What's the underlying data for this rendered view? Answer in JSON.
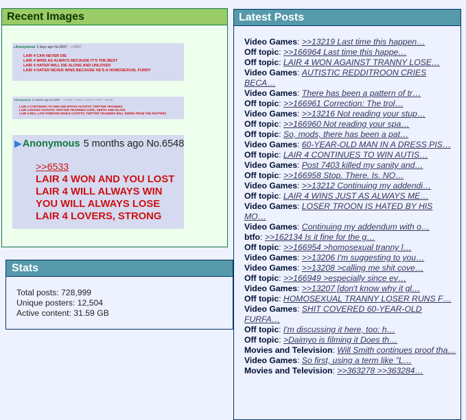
{
  "recent_images": {
    "title": "Recent Images",
    "thumbs": [
      {
        "poster": "Anonymous",
        "meta": "3 days ago No.8827",
        "mini": ">>8847",
        "lines": [
          "LAIR 4 CAN NEVER DIE",
          "LAIR 4 WINS AS ALWAYS BECAUSE IT'S THE BEST",
          "LAIR 4 HATER WILL DIE ALONE AND UNLOVED",
          "LAIR 4 HATER NEVER WINS BECAUSE HE'S A HOMOSEXUAL FURRY"
        ]
      },
      {
        "poster": "Anonymous",
        "meta": "5 months ago No.6525",
        "mini": ">>6533  >>6534  >>6535  >>6537  >>6538",
        "lines": [
          "LAIR 4 CONTINUES TO WIN AND BTFOS AUTISTIC TWITTER TRANNIES",
          "LAIR 4 MAKES AUTISTIC TWITTER TRANNIES COPE, SEETH AND DILATE",
          "LAIR 4 WILL LIVE FOREVER WHILE AUTISTIC TWITTER TRANNIES WILL SWING FROM THE RAFTERS"
        ]
      },
      {
        "poster": "Anonymous",
        "meta": "5 months ago No.6548",
        "quote": ">>6533",
        "lines": [
          "LAIR 4 WON AND YOU LOST",
          "LAIR 4 WILL ALWAYS WIN",
          "YOU WILL ALWAYS LOSE",
          "LAIR 4 LOVERS, STRONG"
        ]
      }
    ]
  },
  "stats": {
    "title": "Stats",
    "total_posts": "Total posts: 728,999",
    "unique_posters": "Unique posters: 12,504",
    "active_content": "Active content: 31.59 GB"
  },
  "latest_posts": {
    "title": "Latest Posts",
    "items": [
      {
        "board": "Video Games",
        "text": ">>13219 Last time this happen…"
      },
      {
        "board": "Off topic",
        "text": ">>166964 Last time this happe…"
      },
      {
        "board": "Off topic",
        "text": "LAIR 4 WON AGAINST TRANNY LOSE…"
      },
      {
        "board": "Video Games",
        "text": "AUTISTIC REDDITROON CRIES BECA…"
      },
      {
        "board": "Video Games",
        "text": "There has been a pattern of tr…"
      },
      {
        "board": "Off topic",
        "text": ">>166961 Correction: The trol…"
      },
      {
        "board": "Video Games",
        "text": ">>13216 Not reading your stup…"
      },
      {
        "board": "Off topic",
        "text": ">>166960 Not reading your spa…"
      },
      {
        "board": "Off topic",
        "text": "So, mods, there has been a pat…"
      },
      {
        "board": "Video Games",
        "text": "60-YEAR-OLD MAN IN A DRESS PIS…"
      },
      {
        "board": "Off topic",
        "text": "LAIR 4 CONTINUES TO WIN AUTIS…"
      },
      {
        "board": "Video Games",
        "text": "Post 7403 killed my sanity and…"
      },
      {
        "board": "Off topic",
        "text": ">>166958 Stop. There. Is. NO…"
      },
      {
        "board": "Video Games",
        "text": ">>13212 Continuing my addendi…"
      },
      {
        "board": "Off topic",
        "text": "LAIR 4 WINS JUST AS ALWAYS ME…"
      },
      {
        "board": "Video Games",
        "text": "LOSER TROON IS HATED BY HIS MO…"
      },
      {
        "board": "Video Games",
        "text": "Continuing my addendum with o…"
      },
      {
        "board": "btfo",
        "text": ">>162134 Is it fine for the g…"
      },
      {
        "board": "Off topic",
        "text": ">>166954 >homosexual tranny l…"
      },
      {
        "board": "Video Games",
        "text": ">>13206 I'm suggesting to you…"
      },
      {
        "board": "Video Games",
        "text": ">>13208 >calling me shit cove…"
      },
      {
        "board": "Off topic",
        "text": ">>166949 >especially since ev…"
      },
      {
        "board": "Video Games",
        "text": ">>13207 [don't know why it gl…"
      },
      {
        "board": "Off topic",
        "text": "HOMOSEXUAL TRANNY LOSER RUNS F…"
      },
      {
        "board": "Video Games",
        "text": "SHIT COVERED 60-YEAR-OLD FURFA…"
      },
      {
        "board": "Off topic",
        "text": "I'm discussing it here, too: h…"
      },
      {
        "board": "Off topic",
        "text": ">Daimyo is filming it Does th…"
      },
      {
        "board": "Movies and Television",
        "text": "Will Smith continues proof tha…"
      },
      {
        "board": "Video Games",
        "text": "So first, using a term like \"L…"
      },
      {
        "board": "Movies and Television",
        "text": ">>363278 >>363284…"
      }
    ]
  }
}
